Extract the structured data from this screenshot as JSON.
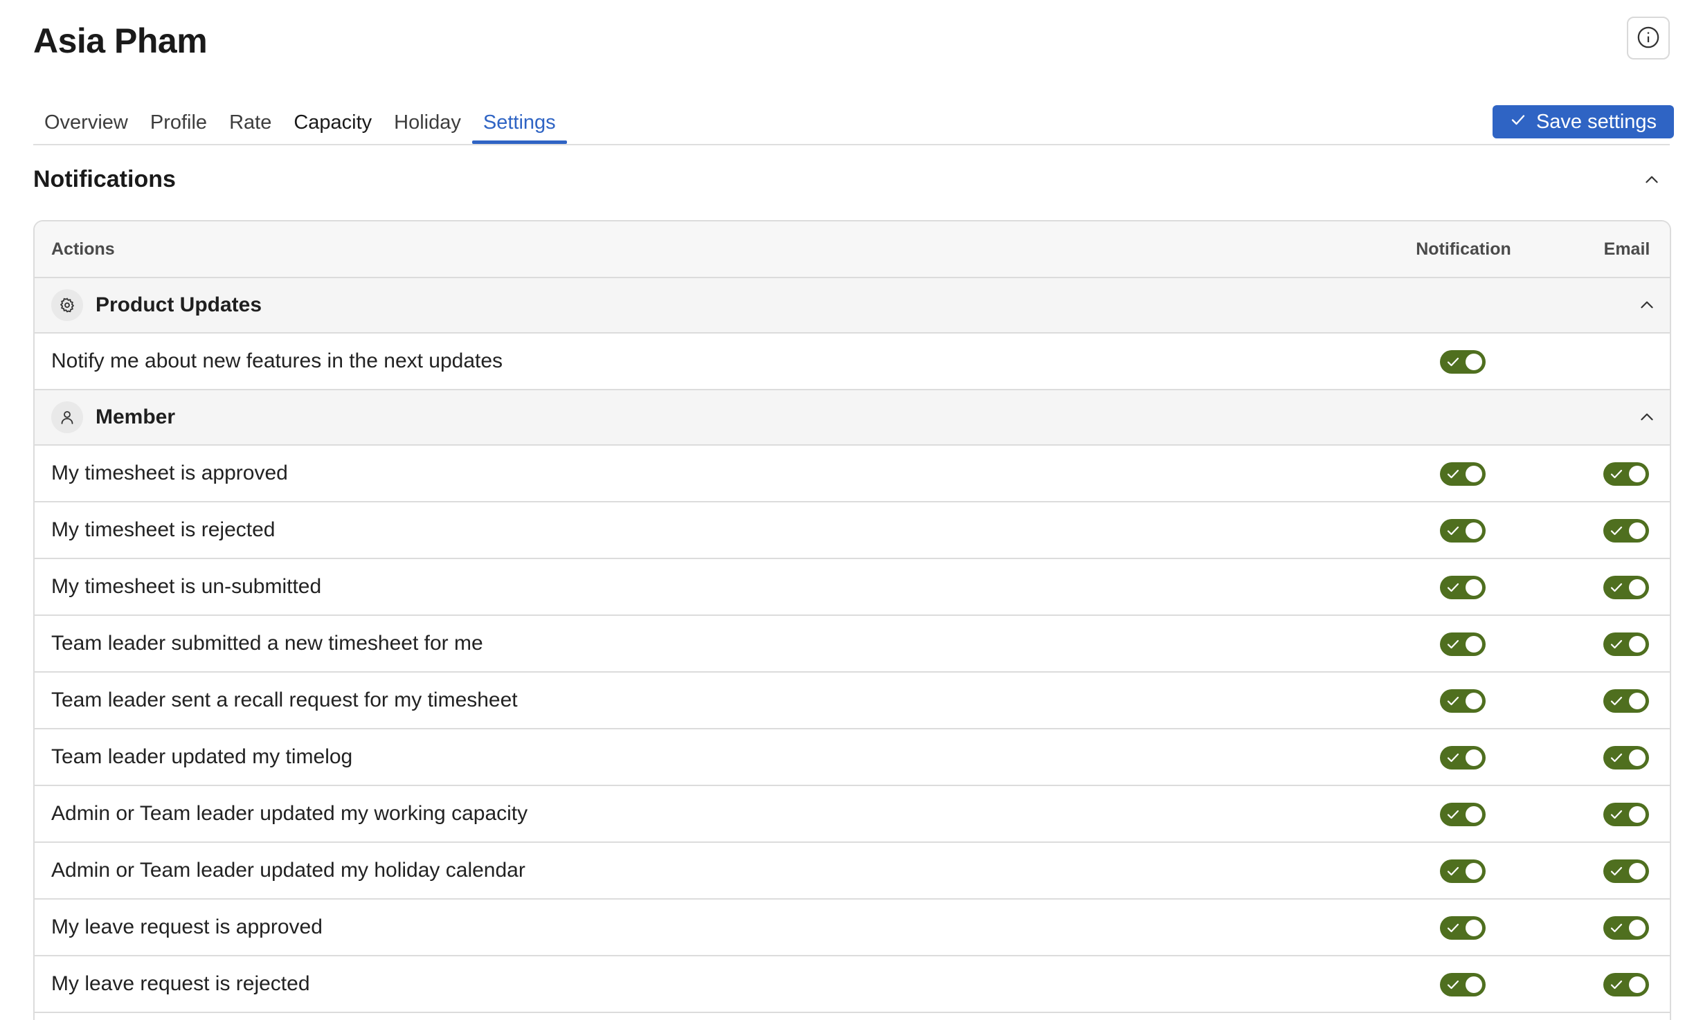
{
  "header": {
    "title": "Asia Pham",
    "info_icon": "info-circle-icon"
  },
  "tabs": [
    {
      "label": "Overview",
      "active": false
    },
    {
      "label": "Profile",
      "active": false
    },
    {
      "label": "Rate",
      "active": false
    },
    {
      "label": "Capacity",
      "active": false
    },
    {
      "label": "Holiday",
      "active": false
    },
    {
      "label": "Settings",
      "active": true
    }
  ],
  "toolbar": {
    "save_label": "Save settings",
    "save_icon": "check-icon"
  },
  "notifications": {
    "title": "Notifications",
    "collapse_icon": "chevron-up-icon",
    "columns": {
      "actions": "Actions",
      "notification": "Notification",
      "email": "Email"
    },
    "groups": [
      {
        "label": "Product Updates",
        "icon": "gear-icon",
        "rows": [
          {
            "label": "Notify me about new features in the next updates",
            "notification": true,
            "email": null
          }
        ]
      },
      {
        "label": "Member",
        "icon": "user-icon",
        "rows": [
          {
            "label": "My timesheet is approved",
            "notification": true,
            "email": true
          },
          {
            "label": "My timesheet is rejected",
            "notification": true,
            "email": true
          },
          {
            "label": "My timesheet is un-submitted",
            "notification": true,
            "email": true
          },
          {
            "label": "Team leader submitted a new timesheet for me",
            "notification": true,
            "email": true
          },
          {
            "label": "Team leader sent a recall request for my timesheet",
            "notification": true,
            "email": true
          },
          {
            "label": "Team leader updated my timelog",
            "notification": true,
            "email": true
          },
          {
            "label": "Admin or Team leader updated my working capacity",
            "notification": true,
            "email": true
          },
          {
            "label": "Admin or Team leader updated my holiday calendar",
            "notification": true,
            "email": true
          },
          {
            "label": "My leave request is approved",
            "notification": true,
            "email": true
          },
          {
            "label": "My leave request is rejected",
            "notification": true,
            "email": true
          }
        ]
      }
    ]
  },
  "colors": {
    "accent": "#2f64c4",
    "toggle_on": "#4f6f1f",
    "border": "#dcdcdc"
  }
}
